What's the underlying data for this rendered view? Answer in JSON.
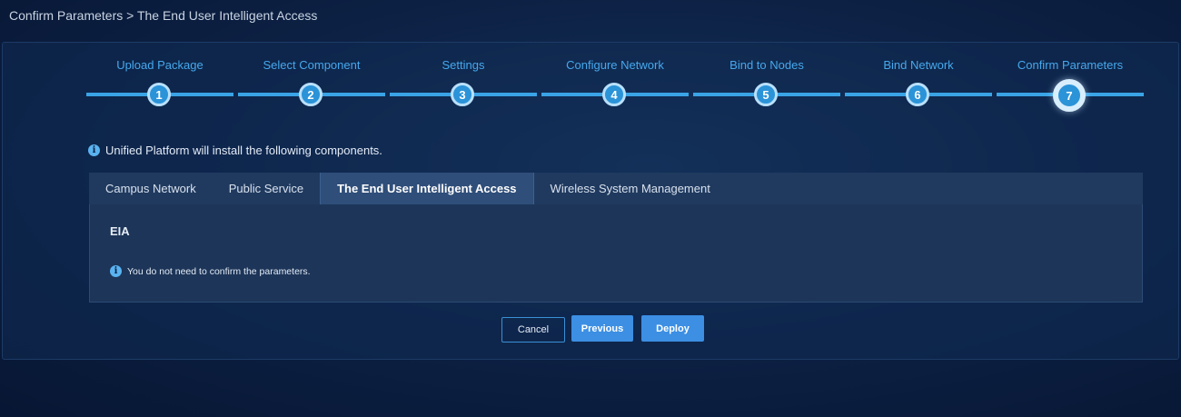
{
  "breadcrumb": "Confirm Parameters > The End User Intelligent Access",
  "steps": [
    {
      "number": "1",
      "label": "Upload Package"
    },
    {
      "number": "2",
      "label": "Select Component"
    },
    {
      "number": "3",
      "label": "Settings"
    },
    {
      "number": "4",
      "label": "Configure Network"
    },
    {
      "number": "5",
      "label": "Bind to Nodes"
    },
    {
      "number": "6",
      "label": "Bind Network"
    },
    {
      "number": "7",
      "label": "Confirm Parameters"
    }
  ],
  "active_step": 7,
  "info_text": "Unified Platform will install the following components.",
  "tabs": [
    {
      "label": "Campus Network"
    },
    {
      "label": "Public Service"
    },
    {
      "label": "The End User Intelligent Access"
    },
    {
      "label": "Wireless System Management"
    }
  ],
  "active_tab": 3,
  "content": {
    "title": "EIA",
    "notice": "You do not need to confirm the parameters."
  },
  "buttons": {
    "cancel": "Cancel",
    "previous": "Previous",
    "deploy": "Deploy"
  },
  "icons": {
    "info": "info-icon"
  },
  "colors": {
    "accent": "#3aa3e6",
    "primary_button": "#3c8fe3",
    "step_label": "#46a8ec"
  }
}
